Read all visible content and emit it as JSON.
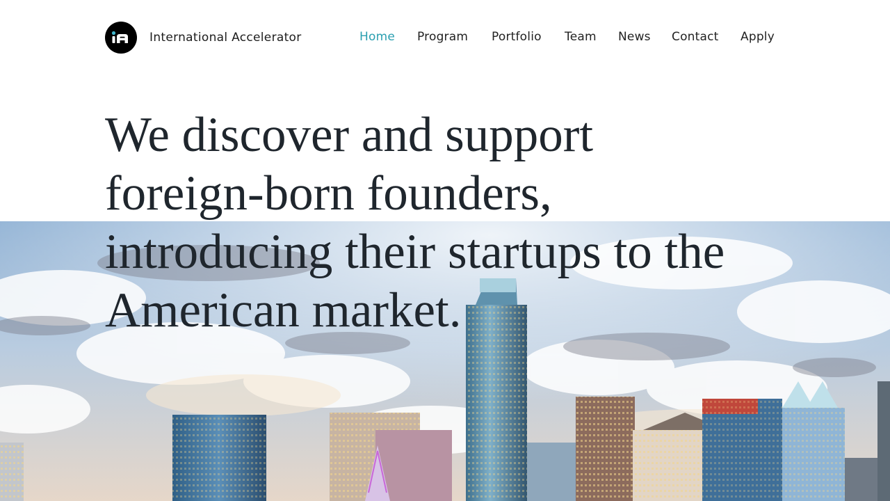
{
  "brand": {
    "name": "International Accelerator",
    "logo_icon": "ia-logo-icon"
  },
  "nav": {
    "active_color": "#2a9fb0",
    "items": [
      {
        "label": "Home",
        "active": true
      },
      {
        "label": "Program",
        "active": false
      },
      {
        "label": "Portfolio",
        "active": false
      },
      {
        "label": "Team",
        "active": false
      },
      {
        "label": "News",
        "active": false
      },
      {
        "label": "Contact",
        "active": false
      },
      {
        "label": "Apply",
        "active": false
      }
    ]
  },
  "hero": {
    "headline_lines": [
      "We discover and support",
      "foreign-born founders,",
      "introducing their startups to the",
      "American market."
    ],
    "image": "city-skyline-image"
  }
}
